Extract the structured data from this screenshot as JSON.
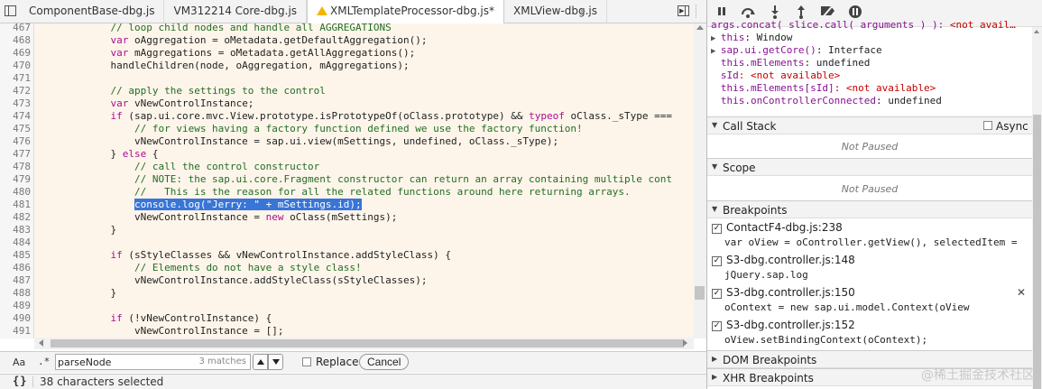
{
  "tabs": [
    {
      "label": "ComponentBase-dbg.js",
      "active": false,
      "warning": false
    },
    {
      "label": "VM312214 Core-dbg.js",
      "active": false,
      "warning": false
    },
    {
      "label": "XMLTemplateProcessor-dbg.js*",
      "active": true,
      "warning": true
    },
    {
      "label": "XMLView-dbg.js",
      "active": false,
      "warning": false
    }
  ],
  "overflow_label": "»",
  "code_lines": [
    {
      "n": "467",
      "text": "            // loop child nodes and handle all AGGREGATIONS"
    },
    {
      "n": "468",
      "text": "            var oAggregation = oMetadata.getDefaultAggregation();"
    },
    {
      "n": "469",
      "text": "            var mAggregations = oMetadata.getAllAggregations();"
    },
    {
      "n": "470",
      "text": "            handleChildren(node, oAggregation, mAggregations);"
    },
    {
      "n": "471",
      "text": ""
    },
    {
      "n": "472",
      "text": "            // apply the settings to the control"
    },
    {
      "n": "473",
      "text": "            var vNewControlInstance;"
    },
    {
      "n": "474",
      "text": "            if (sap.ui.core.mvc.View.prototype.isPrototypeOf(oClass.prototype) && typeof oClass._sType ==="
    },
    {
      "n": "475",
      "text": "                // for views having a factory function defined we use the factory function!"
    },
    {
      "n": "476",
      "text": "                vNewControlInstance = sap.ui.view(mSettings, undefined, oClass._sType);"
    },
    {
      "n": "477",
      "text": "            } else {"
    },
    {
      "n": "478",
      "text": "                // call the control constructor"
    },
    {
      "n": "479",
      "text": "                // NOTE: the sap.ui.core.Fragment constructor can return an array containing multiple cont"
    },
    {
      "n": "480",
      "text": "                //   This is the reason for all the related functions around here returning arrays."
    },
    {
      "n": "481",
      "text": "                console.log(\"Jerry: \" + mSettings.id);",
      "selected": true
    },
    {
      "n": "482",
      "text": "                vNewControlInstance = new oClass(mSettings);"
    },
    {
      "n": "483",
      "text": "            }"
    },
    {
      "n": "484",
      "text": ""
    },
    {
      "n": "485",
      "text": "            if (sStyleClasses && vNewControlInstance.addStyleClass) {"
    },
    {
      "n": "486",
      "text": "                // Elements do not have a style class!"
    },
    {
      "n": "487",
      "text": "                vNewControlInstance.addStyleClass(sStyleClasses);"
    },
    {
      "n": "488",
      "text": "            }"
    },
    {
      "n": "489",
      "text": ""
    },
    {
      "n": "490",
      "text": "            if (!vNewControlInstance) {"
    },
    {
      "n": "491",
      "text": "                vNewControlInstance = [];"
    },
    {
      "n": "492",
      "text": ""
    }
  ],
  "find": {
    "aa_label": "Aa",
    "regex_label": ".*",
    "query": "parseNode",
    "matches": "3 matches",
    "replace_label": "Replace",
    "cancel_label": "Cancel"
  },
  "status": {
    "pretty_label": "{}",
    "text": "38 characters selected"
  },
  "scope_vars": [
    {
      "prefix": "",
      "name": "args.concat( slice.call( arguments ) ):",
      "value": " <not avail…",
      "name_color": "purple",
      "value_color": "na"
    },
    {
      "prefix": "▶ ",
      "name": "this",
      "value": ": Window",
      "name_color": "purple",
      "value_color": "plain"
    },
    {
      "prefix": "▶ ",
      "name": "sap.ui.getCore()",
      "value": ": Interface",
      "name_color": "purple",
      "value_color": "plain"
    },
    {
      "prefix": "  ",
      "name": "this.mElements",
      "value": ": undefined",
      "name_color": "purple",
      "value_color": "plain"
    },
    {
      "prefix": "  ",
      "name": "sId",
      "value": ": <not available>",
      "name_color": "purple",
      "value_color": "na"
    },
    {
      "prefix": "  ",
      "name": "this.mElements[sId]",
      "value": ": <not available>",
      "name_color": "purple",
      "value_color": "na"
    },
    {
      "prefix": "  ",
      "name": "this.onControllerConnected",
      "value": ": undefined",
      "name_color": "purple",
      "value_color": "plain"
    }
  ],
  "sections": {
    "call_stack": "Call Stack",
    "async_label": "Async",
    "call_stack_status": "Not Paused",
    "scope": "Scope",
    "scope_status": "Not Paused",
    "breakpoints": "Breakpoints",
    "dom_breakpoints": "DOM Breakpoints",
    "xhr_breakpoints": "XHR Breakpoints"
  },
  "breakpoints": [
    {
      "file": "ContactF4-dbg.js:238",
      "code": "var oView = oController.getView(), selectedItem =",
      "checked": true,
      "closable": false
    },
    {
      "file": "S3-dbg.controller.js:148",
      "code": "jQuery.sap.log",
      "checked": true,
      "closable": false
    },
    {
      "file": "S3-dbg.controller.js:150",
      "code": "oContext = new sap.ui.model.Context(oView",
      "checked": true,
      "closable": true
    },
    {
      "file": "S3-dbg.controller.js:152",
      "code": "oView.setBindingContext(oContext);",
      "checked": true,
      "closable": false
    }
  ],
  "watermark": "@稀土掘金技术社区",
  "colors": {
    "keyword": "#aa0d91",
    "comment": "#236e25",
    "string": "#1a1aa6",
    "selection": "#3875d7",
    "code_bg": "#fdf5ea"
  }
}
